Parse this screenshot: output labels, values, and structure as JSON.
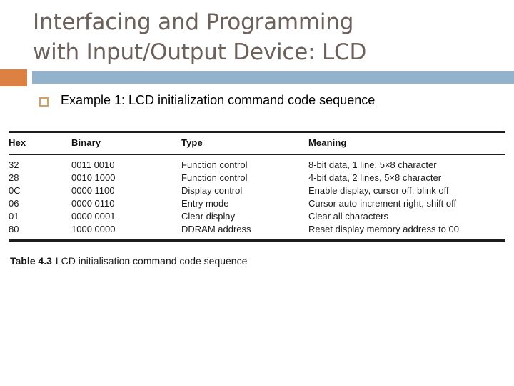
{
  "slide": {
    "title_lines": [
      "Interfacing and Programming",
      "with Input/Output Device: LCD"
    ],
    "bullet": {
      "marker": "square-bullet-icon",
      "text": "Example 1: LCD initialization command code sequence"
    },
    "colors": {
      "title": "#6d615b",
      "accent_orange": "#dd8143",
      "accent_blue": "#92b2ce",
      "bullet_marker": "#d3a06a",
      "rule": "#1c1c1c",
      "body_text": "#1a1a1a",
      "background": "#ffffff"
    }
  },
  "table": {
    "columns": [
      "Hex",
      "Binary",
      "Type",
      "Meaning"
    ],
    "rows": [
      {
        "hex": "32",
        "binary": "0011 0010",
        "type": "Function control",
        "meaning": "8-bit data, 1 line, 5×8 character"
      },
      {
        "hex": "28",
        "binary": "0010 1000",
        "type": "Function control",
        "meaning": "4-bit data, 2 lines, 5×8 character"
      },
      {
        "hex": "0C",
        "binary": "0000 1100",
        "type": "Display control",
        "meaning": "Enable display, cursor off, blink off"
      },
      {
        "hex": "06",
        "binary": "0000 0110",
        "type": "Entry mode",
        "meaning": "Cursor auto-increment right, shift off"
      },
      {
        "hex": "01",
        "binary": "0000 0001",
        "type": "Clear display",
        "meaning": "Clear all characters"
      },
      {
        "hex": "80",
        "binary": "1000 0000",
        "type": "DDRAM address",
        "meaning": "Reset display memory address to 00"
      }
    ],
    "caption": {
      "label": "Table 4.3",
      "text": "LCD initialisation command code sequence"
    }
  }
}
